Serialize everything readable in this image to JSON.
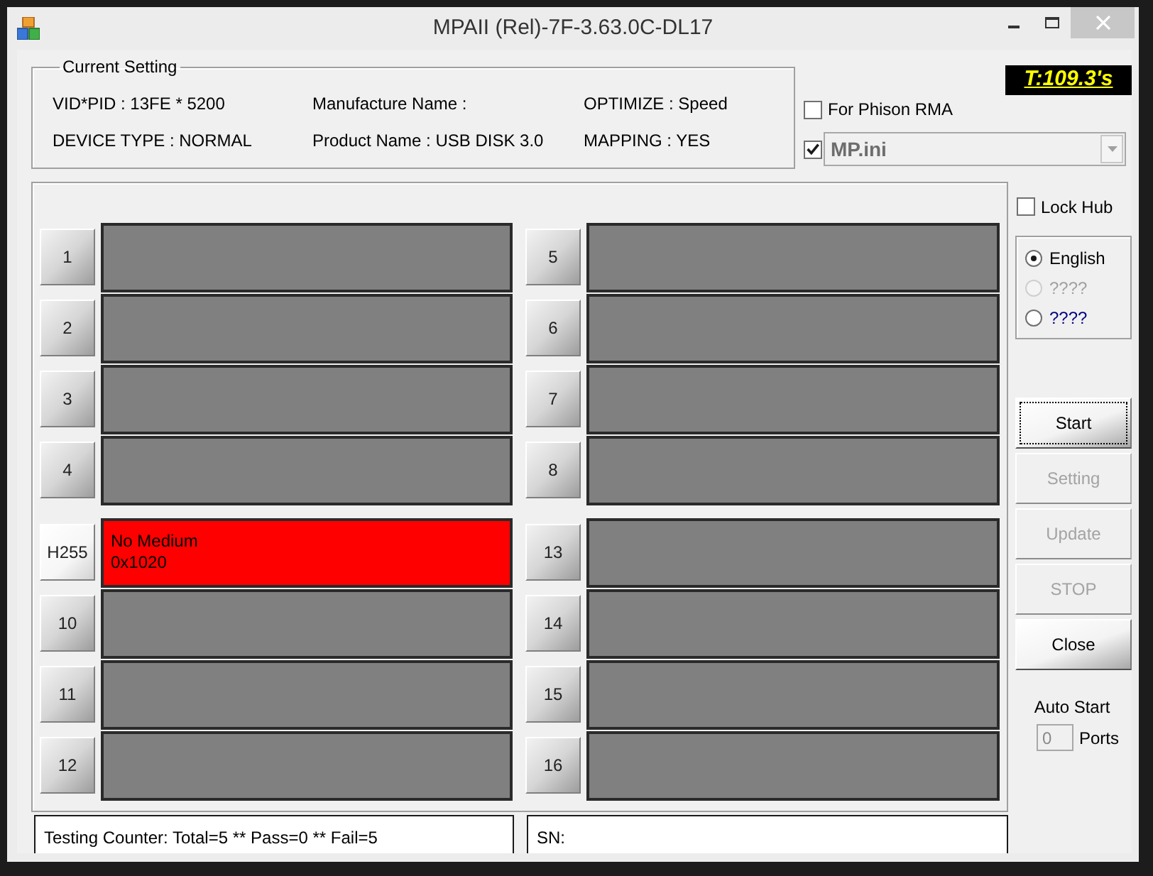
{
  "window": {
    "title": "MPAII (Rel)-7F-3.63.0C-DL17"
  },
  "current_setting": {
    "title": "Current Setting",
    "fields": [
      "VID*PID : 13FE * 5200",
      "Manufacture Name :",
      "OPTIMIZE : Speed",
      "DEVICE TYPE : NORMAL",
      "Product Name : USB DISK 3.0",
      "MAPPING : YES"
    ]
  },
  "timer": "T:109.3's",
  "phison_rma": {
    "label": "For Phison RMA",
    "checked": false
  },
  "ini_file": {
    "checked": true,
    "value": "MP.ini",
    "disabled": true
  },
  "port_blocks": [
    {
      "left": [
        {
          "label": "1",
          "failed": false
        },
        {
          "label": "2",
          "failed": false
        },
        {
          "label": "3",
          "failed": false
        },
        {
          "label": "4",
          "failed": false
        }
      ],
      "right": [
        {
          "label": "5",
          "failed": false
        },
        {
          "label": "6",
          "failed": false
        },
        {
          "label": "7",
          "failed": false
        },
        {
          "label": "8",
          "failed": false
        }
      ]
    },
    {
      "left": [
        {
          "label": "H255",
          "failed": true,
          "lines": [
            "No Medium",
            "0x1020"
          ]
        },
        {
          "label": "10",
          "failed": false
        },
        {
          "label": "11",
          "failed": false
        },
        {
          "label": "12",
          "failed": false
        }
      ],
      "right": [
        {
          "label": "13",
          "failed": false
        },
        {
          "label": "14",
          "failed": false
        },
        {
          "label": "15",
          "failed": false
        },
        {
          "label": "16",
          "failed": false
        }
      ]
    }
  ],
  "status": {
    "counter": "Testing Counter: Total=5 ** Pass=0 ** Fail=5",
    "sn": "SN:"
  },
  "lock_hub": {
    "label": "Lock Hub",
    "checked": false
  },
  "language": [
    {
      "label": "English",
      "selected": true,
      "disabled": false,
      "color": "#000000"
    },
    {
      "label": "????",
      "selected": false,
      "disabled": true,
      "color": "#a0a0a0"
    },
    {
      "label": "????",
      "selected": false,
      "disabled": false,
      "color": "#000080"
    }
  ],
  "buttons": [
    {
      "label": "Start",
      "disabled": false,
      "focused": true
    },
    {
      "label": "Setting",
      "disabled": true,
      "focused": false
    },
    {
      "label": "Update",
      "disabled": true,
      "focused": false
    },
    {
      "label": "STOP",
      "disabled": true,
      "focused": false
    },
    {
      "label": "Close",
      "disabled": false,
      "focused": false
    }
  ],
  "auto_start": {
    "label": "Auto Start",
    "value": "0",
    "disabled": true,
    "unit": "Ports"
  }
}
